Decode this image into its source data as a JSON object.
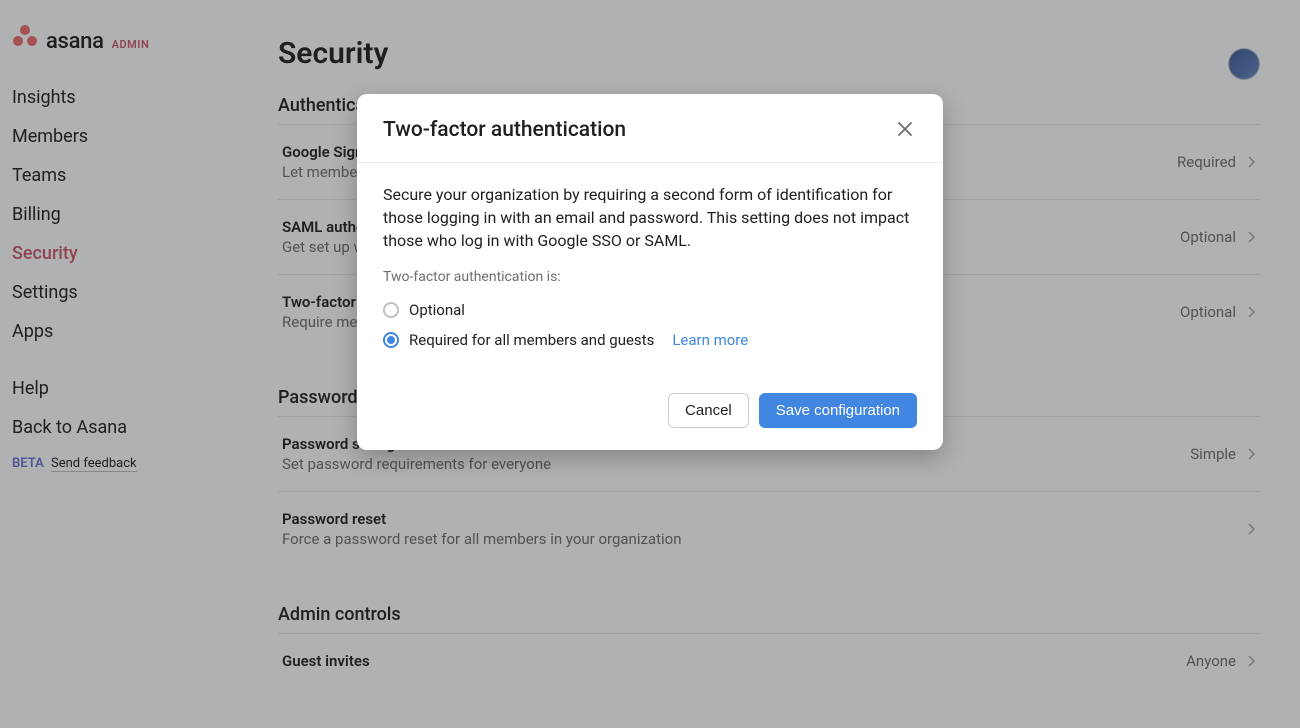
{
  "brand": {
    "name": "asana",
    "admin_label": "ADMIN"
  },
  "sidebar": {
    "items": [
      "Insights",
      "Members",
      "Teams",
      "Billing",
      "Security",
      "Settings",
      "Apps"
    ],
    "help_items": [
      "Help",
      "Back to Asana"
    ],
    "beta_label": "BETA",
    "feedback_label": "Send feedback",
    "active": "Security"
  },
  "page": {
    "title": "Security",
    "sections": [
      {
        "heading": "Authentication",
        "rows": [
          {
            "title": "Google Sign-In",
            "desc": "Let members sign in with Google",
            "value": "Required"
          },
          {
            "title": "SAML authentication",
            "desc": "Get set up with SAML-based single sign-on",
            "value": "Optional"
          },
          {
            "title": "Two-factor authentication",
            "desc": "Require members to use two-factor authentication",
            "value": "Optional"
          }
        ]
      },
      {
        "heading": "Password settings",
        "rows": [
          {
            "title": "Password strength",
            "desc": "Set password requirements for everyone",
            "value": "Simple"
          },
          {
            "title": "Password reset",
            "desc": "Force a password reset for all members in your organization",
            "value": ""
          }
        ]
      },
      {
        "heading": "Admin controls",
        "rows": [
          {
            "title": "Guest invites",
            "desc": "",
            "value": "Anyone"
          }
        ]
      }
    ]
  },
  "modal": {
    "title": "Two-factor authentication",
    "desc": "Secure your organization by requiring a second form of identification for those logging in with an email and password. This setting does not impact those who log in with Google SSO or SAML.",
    "field_label": "Two-factor authentication is:",
    "option_optional": "Optional",
    "option_required": "Required for all members and guests",
    "learn_more": "Learn more",
    "cancel": "Cancel",
    "save": "Save configuration",
    "selected": "required"
  }
}
